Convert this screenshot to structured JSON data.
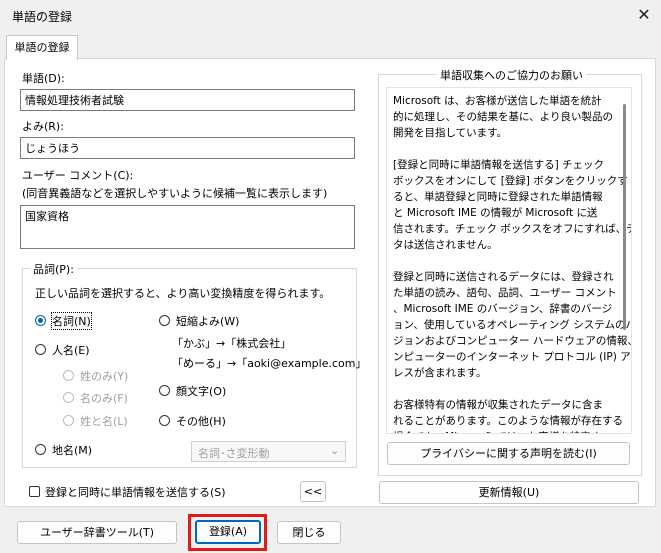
{
  "window": {
    "title": "単語の登録"
  },
  "tab": {
    "label": "単語の登録"
  },
  "word": {
    "label": "単語(D):",
    "value": "情報処理技術者試験"
  },
  "reading": {
    "label": "よみ(R):",
    "value": "じょうほう"
  },
  "comment": {
    "label": "ユーザー コメント(C):",
    "hint": "(同音異義語などを選択しやすいように候補一覧に表示します)",
    "value": "国家資格"
  },
  "pos": {
    "legend": "品詞(P):",
    "desc": "正しい品詞を選択すると、より高い変換精度を得られます。",
    "noun": "名詞(N)",
    "person": "人名(E)",
    "surname": "姓のみ(Y)",
    "given": "名のみ(F)",
    "fullname": "姓と名(L)",
    "place": "地名(M)",
    "abbrev": "短縮よみ(W)",
    "ex1": "「かぶ」→「株式会社」",
    "ex2": "「めーる」→「aoki@example.com」",
    "emoticon": "顔文字(O)",
    "other": "その他(H)",
    "subtype": "名詞･さ変形動"
  },
  "send": {
    "label": "登録と同時に単語情報を送信する(S)",
    "collapse": "<<"
  },
  "info": {
    "legend": "単語収集へのご協力のお願い",
    "p1": "Microsoft は、お客様が送信した単語を統計\n的に処理し、その結果を基に、より良い製品の\n開発を目指しています。",
    "p2": "[登録と同時に単語情報を送信する] チェック\nボックスをオンにして [登録] ボタンをクリックす\nると、単語登録と同時に登録された単語情報\nと Microsoft IME の情報が Microsoft に送\n信されます。チェック ボックスをオフにすれば、デー\nタは送信されません。",
    "p3": "登録と同時に送信されるデータには、登録され\nた単語の読み、語句、品詞、ユーザー コメント\n、Microsoft IME のバージョン、辞書のバージ\nョン、使用しているオペレーティング システムのバー\nジョンおよびコンピューター ハードウェアの情報、コ\nンピューターのインターネット プロトコル (IP) アド\nレスが含まれます。",
    "p4": "お客様特有の情報が収集されたデータに含ま\nれることがあります。このような情報が存在する\n場合でも、Microsoft では、お客様を特定す\nるために使用することはありません。",
    "privacy": "プライバシーに関する声明を読む(I)",
    "update": "更新情報(U)"
  },
  "footer": {
    "tool": "ユーザー辞書ツール(T)",
    "register": "登録(A)",
    "close": "閉じる"
  }
}
